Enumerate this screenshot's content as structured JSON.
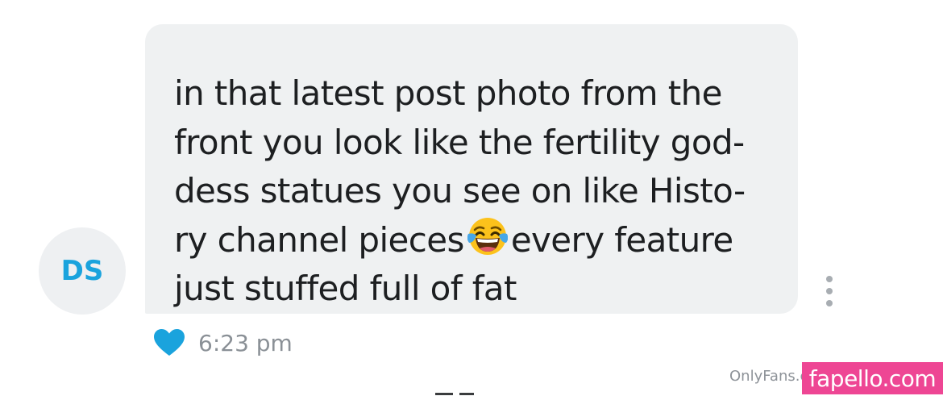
{
  "sender": {
    "initials": "DS",
    "avatar_bg": "#eef0f2",
    "initials_color": "#1aa3dd"
  },
  "message": {
    "lines": [
      "in that latest post photo from the",
      "front you look like the fertility god-",
      "dess statues you see on like Histo-",
      "ry channel pieces",
      "every feature",
      "just stuffed full of fat"
    ],
    "emoji": "face-with-tears-of-joy-icon",
    "bubble_color": "#eff1f2",
    "text_color": "#1d1f21"
  },
  "meta": {
    "time": "6:23 pm",
    "heart_icon": "heart-icon",
    "heart_color": "#1aa3dd"
  },
  "menu": {
    "icon": "more-vertical-icon"
  },
  "footer": {
    "source_text": "OnlyFans.c",
    "watermark_text": "fapello.com",
    "watermark_color": "#ee4694"
  }
}
